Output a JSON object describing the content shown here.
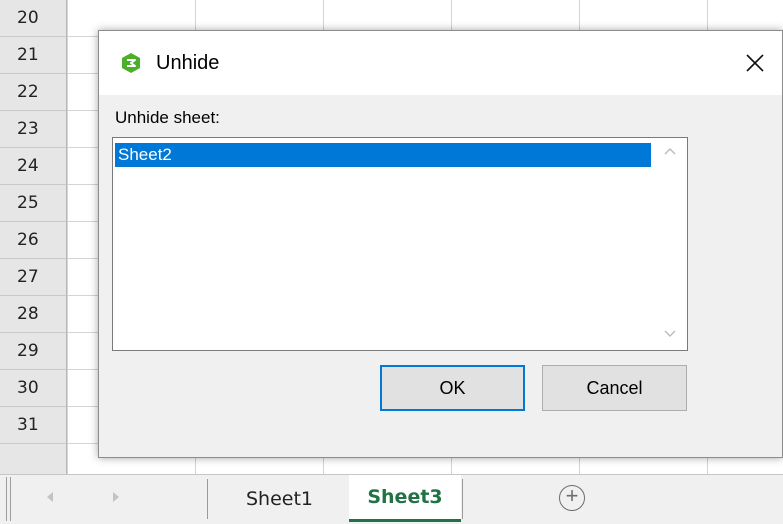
{
  "spreadsheet": {
    "row_numbers": [
      "20",
      "21",
      "22",
      "23",
      "24",
      "25",
      "26",
      "27",
      "28",
      "29",
      "30",
      "31"
    ]
  },
  "dialog": {
    "title": "Unhide",
    "label": "Unhide sheet:",
    "sheets": [
      "Sheet2"
    ],
    "selected_index": 0,
    "ok_label": "OK",
    "cancel_label": "Cancel",
    "close_symbol": "✕",
    "icon": "wps-spreadsheet-icon"
  },
  "tabbar": {
    "tabs": [
      {
        "label": "Sheet1",
        "active": false
      },
      {
        "label": "Sheet3",
        "active": true
      }
    ],
    "add_symbol": "+"
  },
  "colors": {
    "accent": "#0078d7",
    "active_tab": "#217346",
    "app_icon": "#4caf2a"
  }
}
